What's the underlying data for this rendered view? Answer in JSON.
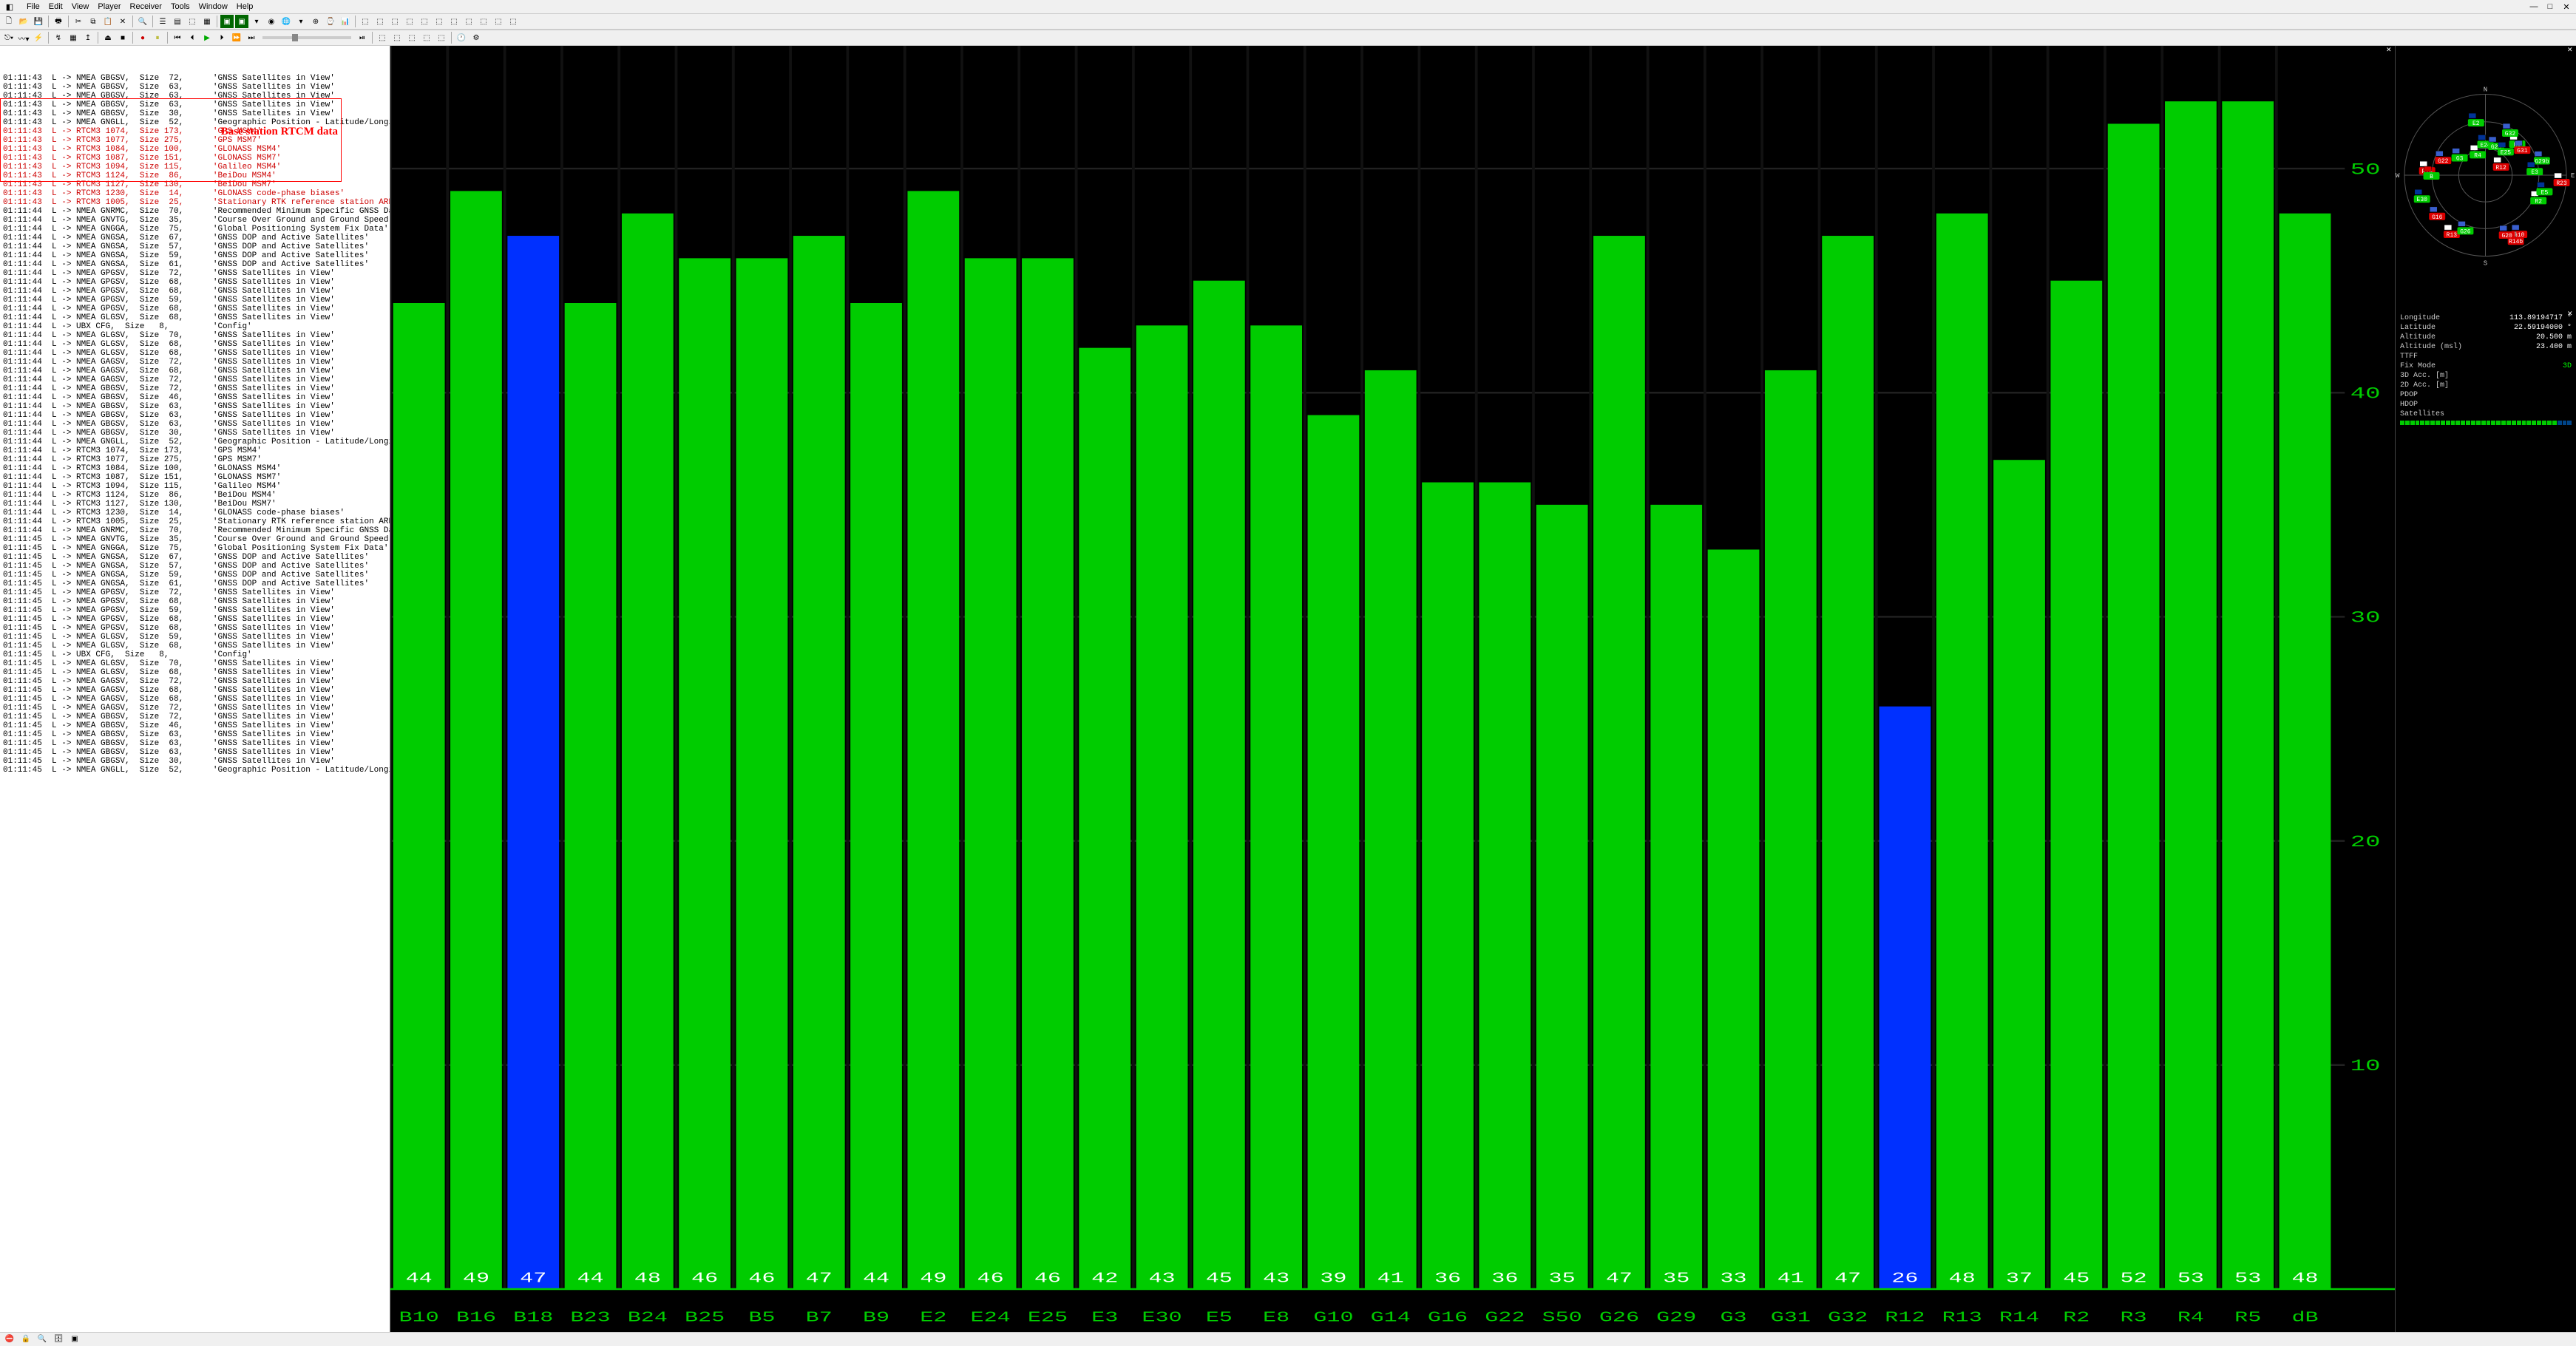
{
  "menu": [
    "File",
    "Edit",
    "View",
    "Player",
    "Receiver",
    "Tools",
    "Window",
    "Help"
  ],
  "annotation_text": "Base station RTCM data",
  "log_lines": [
    {
      "t": "01:11:43",
      "d": "L",
      "msg": "NMEA GBGSV,  Size  72,",
      "desc": "'GNSS Satellites in View'",
      "c": "k"
    },
    {
      "t": "01:11:43",
      "d": "L",
      "msg": "NMEA GBGSV,  Size  63,",
      "desc": "'GNSS Satellites in View'",
      "c": "k"
    },
    {
      "t": "01:11:43",
      "d": "L",
      "msg": "NMEA GBGSV,  Size  63,",
      "desc": "'GNSS Satellites in View'",
      "c": "k"
    },
    {
      "t": "01:11:43",
      "d": "L",
      "msg": "NMEA GBGSV,  Size  63,",
      "desc": "'GNSS Satellites in View'",
      "c": "k"
    },
    {
      "t": "01:11:43",
      "d": "L",
      "msg": "NMEA GBGSV,  Size  30,",
      "desc": "'GNSS Satellites in View'",
      "c": "k"
    },
    {
      "t": "01:11:43",
      "d": "L",
      "msg": "NMEA GNGLL,  Size  52,",
      "desc": "'Geographic Position - Latitude/Longitude'",
      "c": "k"
    },
    {
      "t": "01:11:43",
      "d": "L",
      "msg": "RTCM3 1074,  Size 173,",
      "desc": "'GPS MSM4'",
      "c": "r"
    },
    {
      "t": "01:11:43",
      "d": "L",
      "msg": "RTCM3 1077,  Size 275,",
      "desc": "'GPS MSM7'",
      "c": "r"
    },
    {
      "t": "01:11:43",
      "d": "L",
      "msg": "RTCM3 1084,  Size 100,",
      "desc": "'GLONASS MSM4'",
      "c": "r"
    },
    {
      "t": "01:11:43",
      "d": "L",
      "msg": "RTCM3 1087,  Size 151,",
      "desc": "'GLONASS MSM7'",
      "c": "r"
    },
    {
      "t": "01:11:43",
      "d": "L",
      "msg": "RTCM3 1094,  Size 115,",
      "desc": "'Galileo MSM4'",
      "c": "r"
    },
    {
      "t": "01:11:43",
      "d": "L",
      "msg": "RTCM3 1124,  Size  86,",
      "desc": "'BeiDou MSM4'",
      "c": "r"
    },
    {
      "t": "01:11:43",
      "d": "L",
      "msg": "RTCM3 1127,  Size 130,",
      "desc": "'BeiDou MSM7'",
      "c": "r"
    },
    {
      "t": "01:11:43",
      "d": "L",
      "msg": "RTCM3 1230,  Size  14,",
      "desc": "'GLONASS code-phase biases'",
      "c": "r"
    },
    {
      "t": "01:11:43",
      "d": "L",
      "msg": "RTCM3 1005,  Size  25,",
      "desc": "'Stationary RTK reference station ARP'",
      "c": "r"
    },
    {
      "t": "01:11:44",
      "d": "L",
      "msg": "NMEA GNRMC,  Size  70,",
      "desc": "'Recommended Minimum Specific GNSS Data'",
      "c": "k"
    },
    {
      "t": "01:11:44",
      "d": "L",
      "msg": "NMEA GNVTG,  Size  35,",
      "desc": "'Course Over Ground and Ground Speed'",
      "c": "k"
    },
    {
      "t": "01:11:44",
      "d": "L",
      "msg": "NMEA GNGGA,  Size  75,",
      "desc": "'Global Positioning System Fix Data'",
      "c": "k"
    },
    {
      "t": "01:11:44",
      "d": "L",
      "msg": "NMEA GNGSA,  Size  67,",
      "desc": "'GNSS DOP and Active Satellites'",
      "c": "k"
    },
    {
      "t": "01:11:44",
      "d": "L",
      "msg": "NMEA GNGSA,  Size  57,",
      "desc": "'GNSS DOP and Active Satellites'",
      "c": "k"
    },
    {
      "t": "01:11:44",
      "d": "L",
      "msg": "NMEA GNGSA,  Size  59,",
      "desc": "'GNSS DOP and Active Satellites'",
      "c": "k"
    },
    {
      "t": "01:11:44",
      "d": "L",
      "msg": "NMEA GNGSA,  Size  61,",
      "desc": "'GNSS DOP and Active Satellites'",
      "c": "k"
    },
    {
      "t": "01:11:44",
      "d": "L",
      "msg": "NMEA GPGSV,  Size  72,",
      "desc": "'GNSS Satellites in View'",
      "c": "k"
    },
    {
      "t": "01:11:44",
      "d": "L",
      "msg": "NMEA GPGSV,  Size  68,",
      "desc": "'GNSS Satellites in View'",
      "c": "k"
    },
    {
      "t": "01:11:44",
      "d": "L",
      "msg": "NMEA GPGSV,  Size  68,",
      "desc": "'GNSS Satellites in View'",
      "c": "k"
    },
    {
      "t": "01:11:44",
      "d": "L",
      "msg": "NMEA GPGSV,  Size  59,",
      "desc": "'GNSS Satellites in View'",
      "c": "k"
    },
    {
      "t": "01:11:44",
      "d": "L",
      "msg": "NMEA GPGSV,  Size  68,",
      "desc": "'GNSS Satellites in View'",
      "c": "k"
    },
    {
      "t": "01:11:44",
      "d": "L",
      "msg": "NMEA GLGSV,  Size  68,",
      "desc": "'GNSS Satellites in View'",
      "c": "k"
    },
    {
      "t": "01:11:44",
      "d": "L",
      "msg": "UBX CFG,  Size   8,",
      "desc": "'Config'",
      "c": "k"
    },
    {
      "t": "01:11:44",
      "d": "L",
      "msg": "NMEA GLGSV,  Size  70,",
      "desc": "'GNSS Satellites in View'",
      "c": "k"
    },
    {
      "t": "01:11:44",
      "d": "L",
      "msg": "NMEA GLGSV,  Size  68,",
      "desc": "'GNSS Satellites in View'",
      "c": "k"
    },
    {
      "t": "01:11:44",
      "d": "L",
      "msg": "NMEA GLGSV,  Size  68,",
      "desc": "'GNSS Satellites in View'",
      "c": "k"
    },
    {
      "t": "01:11:44",
      "d": "L",
      "msg": "NMEA GAGSV,  Size  72,",
      "desc": "'GNSS Satellites in View'",
      "c": "k"
    },
    {
      "t": "01:11:44",
      "d": "L",
      "msg": "NMEA GAGSV,  Size  68,",
      "desc": "'GNSS Satellites in View'",
      "c": "k"
    },
    {
      "t": "01:11:44",
      "d": "L",
      "msg": "NMEA GAGSV,  Size  72,",
      "desc": "'GNSS Satellites in View'",
      "c": "k"
    },
    {
      "t": "01:11:44",
      "d": "L",
      "msg": "NMEA GBGSV,  Size  72,",
      "desc": "'GNSS Satellites in View'",
      "c": "k"
    },
    {
      "t": "01:11:44",
      "d": "L",
      "msg": "NMEA GBGSV,  Size  46,",
      "desc": "'GNSS Satellites in View'",
      "c": "k"
    },
    {
      "t": "01:11:44",
      "d": "L",
      "msg": "NMEA GBGSV,  Size  63,",
      "desc": "'GNSS Satellites in View'",
      "c": "k"
    },
    {
      "t": "01:11:44",
      "d": "L",
      "msg": "NMEA GBGSV,  Size  63,",
      "desc": "'GNSS Satellites in View'",
      "c": "k"
    },
    {
      "t": "01:11:44",
      "d": "L",
      "msg": "NMEA GBGSV,  Size  63,",
      "desc": "'GNSS Satellites in View'",
      "c": "k"
    },
    {
      "t": "01:11:44",
      "d": "L",
      "msg": "NMEA GBGSV,  Size  30,",
      "desc": "'GNSS Satellites in View'",
      "c": "k"
    },
    {
      "t": "01:11:44",
      "d": "L",
      "msg": "NMEA GNGLL,  Size  52,",
      "desc": "'Geographic Position - Latitude/Longitude'",
      "c": "k"
    },
    {
      "t": "01:11:44",
      "d": "L",
      "msg": "RTCM3 1074,  Size 173,",
      "desc": "'GPS MSM4'",
      "c": "k"
    },
    {
      "t": "01:11:44",
      "d": "L",
      "msg": "RTCM3 1077,  Size 275,",
      "desc": "'GPS MSM7'",
      "c": "k"
    },
    {
      "t": "01:11:44",
      "d": "L",
      "msg": "RTCM3 1084,  Size 100,",
      "desc": "'GLONASS MSM4'",
      "c": "k"
    },
    {
      "t": "01:11:44",
      "d": "L",
      "msg": "RTCM3 1087,  Size 151,",
      "desc": "'GLONASS MSM7'",
      "c": "k"
    },
    {
      "t": "01:11:44",
      "d": "L",
      "msg": "RTCM3 1094,  Size 115,",
      "desc": "'Galileo MSM4'",
      "c": "k"
    },
    {
      "t": "01:11:44",
      "d": "L",
      "msg": "RTCM3 1124,  Size  86,",
      "desc": "'BeiDou MSM4'",
      "c": "k"
    },
    {
      "t": "01:11:44",
      "d": "L",
      "msg": "RTCM3 1127,  Size 130,",
      "desc": "'BeiDou MSM7'",
      "c": "k"
    },
    {
      "t": "01:11:44",
      "d": "L",
      "msg": "RTCM3 1230,  Size  14,",
      "desc": "'GLONASS code-phase biases'",
      "c": "k"
    },
    {
      "t": "01:11:44",
      "d": "L",
      "msg": "RTCM3 1005,  Size  25,",
      "desc": "'Stationary RTK reference station ARP'",
      "c": "k"
    },
    {
      "t": "01:11:44",
      "d": "L",
      "msg": "NMEA GNRMC,  Size  70,",
      "desc": "'Recommended Minimum Specific GNSS Data'",
      "c": "k"
    },
    {
      "t": "01:11:45",
      "d": "L",
      "msg": "NMEA GNVTG,  Size  35,",
      "desc": "'Course Over Ground and Ground Speed'",
      "c": "k"
    },
    {
      "t": "01:11:45",
      "d": "L",
      "msg": "NMEA GNGGA,  Size  75,",
      "desc": "'Global Positioning System Fix Data'",
      "c": "k"
    },
    {
      "t": "01:11:45",
      "d": "L",
      "msg": "NMEA GNGSA,  Size  67,",
      "desc": "'GNSS DOP and Active Satellites'",
      "c": "k"
    },
    {
      "t": "01:11:45",
      "d": "L",
      "msg": "NMEA GNGSA,  Size  57,",
      "desc": "'GNSS DOP and Active Satellites'",
      "c": "k"
    },
    {
      "t": "01:11:45",
      "d": "L",
      "msg": "NMEA GNGSA,  Size  59,",
      "desc": "'GNSS DOP and Active Satellites'",
      "c": "k"
    },
    {
      "t": "01:11:45",
      "d": "L",
      "msg": "NMEA GNGSA,  Size  61,",
      "desc": "'GNSS DOP and Active Satellites'",
      "c": "k"
    },
    {
      "t": "01:11:45",
      "d": "L",
      "msg": "NMEA GPGSV,  Size  72,",
      "desc": "'GNSS Satellites in View'",
      "c": "k"
    },
    {
      "t": "01:11:45",
      "d": "L",
      "msg": "NMEA GPGSV,  Size  68,",
      "desc": "'GNSS Satellites in View'",
      "c": "k"
    },
    {
      "t": "01:11:45",
      "d": "L",
      "msg": "NMEA GPGSV,  Size  59,",
      "desc": "'GNSS Satellites in View'",
      "c": "k"
    },
    {
      "t": "01:11:45",
      "d": "L",
      "msg": "NMEA GPGSV,  Size  68,",
      "desc": "'GNSS Satellites in View'",
      "c": "k"
    },
    {
      "t": "01:11:45",
      "d": "L",
      "msg": "NMEA GPGSV,  Size  68,",
      "desc": "'GNSS Satellites in View'",
      "c": "k"
    },
    {
      "t": "01:11:45",
      "d": "L",
      "msg": "NMEA GLGSV,  Size  59,",
      "desc": "'GNSS Satellites in View'",
      "c": "k"
    },
    {
      "t": "01:11:45",
      "d": "L",
      "msg": "NMEA GLGSV,  Size  68,",
      "desc": "'GNSS Satellites in View'",
      "c": "k"
    },
    {
      "t": "01:11:45",
      "d": "L",
      "msg": "UBX CFG,  Size   8,",
      "desc": "'Config'",
      "c": "k"
    },
    {
      "t": "01:11:45",
      "d": "L",
      "msg": "NMEA GLGSV,  Size  70,",
      "desc": "'GNSS Satellites in View'",
      "c": "k"
    },
    {
      "t": "01:11:45",
      "d": "L",
      "msg": "NMEA GLGSV,  Size  68,",
      "desc": "'GNSS Satellites in View'",
      "c": "k"
    },
    {
      "t": "01:11:45",
      "d": "L",
      "msg": "NMEA GAGSV,  Size  72,",
      "desc": "'GNSS Satellites in View'",
      "c": "k"
    },
    {
      "t": "01:11:45",
      "d": "L",
      "msg": "NMEA GAGSV,  Size  68,",
      "desc": "'GNSS Satellites in View'",
      "c": "k"
    },
    {
      "t": "01:11:45",
      "d": "L",
      "msg": "NMEA GAGSV,  Size  68,",
      "desc": "'GNSS Satellites in View'",
      "c": "k"
    },
    {
      "t": "01:11:45",
      "d": "L",
      "msg": "NMEA GAGSV,  Size  72,",
      "desc": "'GNSS Satellites in View'",
      "c": "k"
    },
    {
      "t": "01:11:45",
      "d": "L",
      "msg": "NMEA GBGSV,  Size  72,",
      "desc": "'GNSS Satellites in View'",
      "c": "k"
    },
    {
      "t": "01:11:45",
      "d": "L",
      "msg": "NMEA GBGSV,  Size  46,",
      "desc": "'GNSS Satellites in View'",
      "c": "k"
    },
    {
      "t": "01:11:45",
      "d": "L",
      "msg": "NMEA GBGSV,  Size  63,",
      "desc": "'GNSS Satellites in View'",
      "c": "k"
    },
    {
      "t": "01:11:45",
      "d": "L",
      "msg": "NMEA GBGSV,  Size  63,",
      "desc": "'GNSS Satellites in View'",
      "c": "k"
    },
    {
      "t": "01:11:45",
      "d": "L",
      "msg": "NMEA GBGSV,  Size  63,",
      "desc": "'GNSS Satellites in View'",
      "c": "k"
    },
    {
      "t": "01:11:45",
      "d": "L",
      "msg": "NMEA GBGSV,  Size  30,",
      "desc": "'GNSS Satellites in View'",
      "c": "k"
    },
    {
      "t": "01:11:45",
      "d": "L",
      "msg": "NMEA GNGLL,  Size  52,",
      "desc": "'Geographic Position - Latitude/Longitude'",
      "c": "k"
    }
  ],
  "chart_data": {
    "type": "bar",
    "ylabel": "dB",
    "ylim": [
      0,
      55
    ],
    "yticks": [
      10,
      20,
      30,
      40,
      50
    ],
    "bars": [
      {
        "id": "B10",
        "v": 44,
        "c": "green"
      },
      {
        "id": "B16",
        "v": 49,
        "c": "green"
      },
      {
        "id": "B18",
        "v": 47,
        "c": "blue"
      },
      {
        "id": "B23",
        "v": 44,
        "c": "green"
      },
      {
        "id": "B24",
        "v": 48,
        "c": "green"
      },
      {
        "id": "B25",
        "v": 46,
        "c": "green"
      },
      {
        "id": "B5",
        "v": 46,
        "c": "green"
      },
      {
        "id": "B7",
        "v": 47,
        "c": "green"
      },
      {
        "id": "B9",
        "v": 44,
        "c": "green"
      },
      {
        "id": "E2",
        "v": 49,
        "c": "green"
      },
      {
        "id": "E24",
        "v": 46,
        "c": "green"
      },
      {
        "id": "E25",
        "v": 46,
        "c": "green"
      },
      {
        "id": "E3",
        "v": 42,
        "c": "green"
      },
      {
        "id": "E30",
        "v": 43,
        "c": "green"
      },
      {
        "id": "E5",
        "v": 45,
        "c": "green"
      },
      {
        "id": "E8",
        "v": 43,
        "c": "green"
      },
      {
        "id": "G10",
        "v": 39,
        "c": "green"
      },
      {
        "id": "G14",
        "v": 41,
        "c": "green"
      },
      {
        "id": "G16",
        "v": 36,
        "c": "green"
      },
      {
        "id": "G22",
        "v": 36,
        "c": "green"
      },
      {
        "id": "S50",
        "v": 35,
        "c": "green"
      },
      {
        "id": "G26",
        "v": 47,
        "c": "green"
      },
      {
        "id": "G29",
        "v": 35,
        "c": "green"
      },
      {
        "id": "G3",
        "v": 33,
        "c": "green"
      },
      {
        "id": "G31",
        "v": 41,
        "c": "green"
      },
      {
        "id": "G32",
        "v": 47,
        "c": "green"
      },
      {
        "id": "R12",
        "v": 26,
        "c": "blue"
      },
      {
        "id": "R13",
        "v": 48,
        "c": "green"
      },
      {
        "id": "R14",
        "v": 37,
        "c": "green"
      },
      {
        "id": "R2",
        "v": 45,
        "c": "green"
      },
      {
        "id": "R3",
        "v": 52,
        "c": "green"
      },
      {
        "id": "R4",
        "v": 53,
        "c": "green"
      },
      {
        "id": "R5",
        "v": 53,
        "c": "green"
      },
      {
        "id": "dB",
        "v": 48,
        "c": "green"
      }
    ]
  },
  "sky": {
    "labels": {
      "n": "N",
      "s": "S",
      "e": "E",
      "w": "W"
    },
    "sats": [
      {
        "id": "R4",
        "az": 340,
        "el": 65,
        "c": "green",
        "f": "ru"
      },
      {
        "id": "G3",
        "az": 305,
        "el": 55,
        "c": "green",
        "f": "us"
      },
      {
        "id": "G22",
        "az": 290,
        "el": 40,
        "c": "red",
        "f": "us"
      },
      {
        "id": "R14",
        "az": 275,
        "el": 25,
        "c": "red",
        "f": "ru"
      },
      {
        "id": "B",
        "az": 270,
        "el": 30,
        "c": "green",
        "f": "cn"
      },
      {
        "id": "E30",
        "az": 250,
        "el": 15,
        "c": "green",
        "f": "eu"
      },
      {
        "id": "G16",
        "az": 230,
        "el": 20,
        "c": "red",
        "f": "us"
      },
      {
        "id": "R13",
        "az": 210,
        "el": 15,
        "c": "red",
        "f": "ru"
      },
      {
        "id": "E24",
        "az": 0,
        "el": 55,
        "c": "green",
        "f": "eu"
      },
      {
        "id": "G29",
        "az": 20,
        "el": 55,
        "c": "green",
        "f": "us"
      },
      {
        "id": "E25",
        "az": 40,
        "el": 55,
        "c": "green",
        "f": "eu"
      },
      {
        "id": "R3",
        "az": 45,
        "el": 40,
        "c": "green",
        "f": "ru"
      },
      {
        "id": "G31",
        "az": 55,
        "el": 40,
        "c": "red",
        "f": "us"
      },
      {
        "id": "G29b",
        "az": 75,
        "el": 25,
        "c": "green",
        "f": "us"
      },
      {
        "id": "R12",
        "az": 60,
        "el": 70,
        "c": "red",
        "f": "ru"
      },
      {
        "id": "E2",
        "az": 350,
        "el": 30,
        "c": "green",
        "f": "eu"
      },
      {
        "id": "G26",
        "az": 200,
        "el": 25,
        "c": "green",
        "f": "us"
      },
      {
        "id": "G10",
        "az": 150,
        "el": 15,
        "c": "red",
        "f": "us"
      },
      {
        "id": "R14b",
        "az": 155,
        "el": 10,
        "c": "red",
        "f": "ru"
      },
      {
        "id": "G20",
        "az": 160,
        "el": 20,
        "c": "red",
        "f": "us"
      },
      {
        "id": "R2",
        "az": 115,
        "el": 25,
        "c": "green",
        "f": "ru"
      },
      {
        "id": "E5",
        "az": 105,
        "el": 22,
        "c": "green",
        "f": "eu"
      },
      {
        "id": "R23",
        "az": 95,
        "el": 5,
        "c": "red",
        "f": "ru"
      },
      {
        "id": "E3",
        "az": 85,
        "el": 35,
        "c": "green",
        "f": "eu"
      },
      {
        "id": "G32",
        "az": 30,
        "el": 35,
        "c": "green",
        "f": "us"
      }
    ]
  },
  "info": {
    "Longitude": "113.89194717 °",
    "Latitude": "22.59194000 °",
    "Altitude": "20.500 m",
    "Altitude_msl": "23.400 m",
    "TTFF": "",
    "FixMode": "3D",
    "3DAcc": "",
    "2DAcc": "",
    "PDOP": "",
    "HDOP": "",
    "Satellites": ""
  },
  "info_labels": {
    "Longitude": "Longitude",
    "Latitude": "Latitude",
    "Altitude": "Altitude",
    "Altitude_msl": "Altitude (msl)",
    "TTFF": "TTFF",
    "FixMode": "Fix Mode",
    "3DAcc": "3D Acc. [m]",
    "2DAcc": "2D Acc. [m]",
    "PDOP": "PDOP",
    "HDOP": "HDOP",
    "Satellites": "Satellites"
  },
  "fixmode_color": "#0f0"
}
